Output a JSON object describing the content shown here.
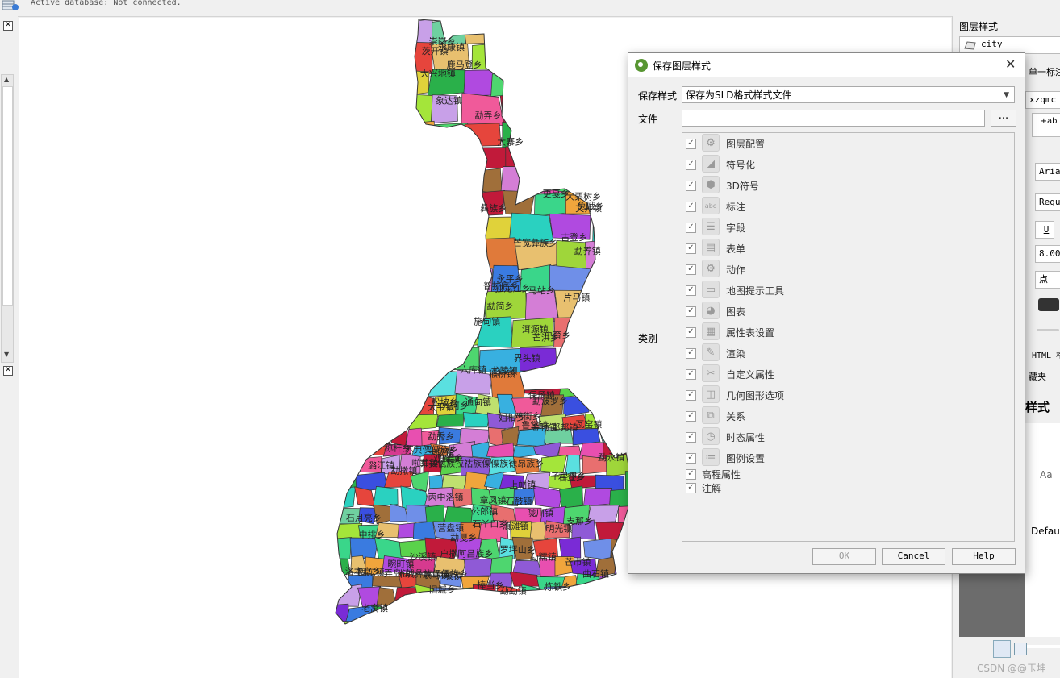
{
  "status": {
    "active_db": "Active database: Not connected."
  },
  "map": {
    "places": [
      "丙中洛镇",
      "捧当乡",
      "独龙江乡",
      "茨开镇",
      "普拉底乡",
      "马吉乡",
      "石月亮乡",
      "鹿马登乡",
      "中排乡",
      "上帕镇",
      "营盘镇",
      "子里甲乡",
      "兔峨乡",
      "石登乡",
      "通甸镇",
      "啦井镇",
      "金顶镇",
      "洛本卓乡",
      "称杆乡",
      "古登乡",
      "片马镇",
      "大兴地镇",
      "鲁掌镇",
      "六库镇",
      "老窝镇",
      "明光镇",
      "滇滩镇",
      "界头镇",
      "马站乡",
      "猴桥镇",
      "固东镇",
      "芒宽彝族乡",
      "苏典傈僳族乡",
      "支那乡",
      "卡场镇",
      "勐弄乡",
      "那邦镇",
      "户撒阿昌族乡",
      "太平镇",
      "勐养镇",
      "陇川镇",
      "章凤镇",
      "勐秀乡",
      "户育乡",
      "弄岛镇",
      "姐相乡",
      "畹町镇",
      "潞江镇",
      "龙陵镇",
      "勐糯镇",
      "永康镇",
      "芒市镇",
      "军赛佤族拉祜族傈僳族德昂族乡",
      "勐永镇",
      "木城彝族傈僳族乡",
      "象达镇",
      "施甸镇",
      "勐波罗乡",
      "九河乡",
      "石鼓镇",
      "洱源镇",
      "罗坪山乡",
      "炼铁乡",
      "双廊镇",
      "永平乡",
      "鸡街乡",
      "勐撒镇",
      "石丫口乡",
      "松坡乡",
      "耿马镇",
      "勐简乡",
      "崇岗乡",
      "芒洪乡",
      "大寨乡",
      "沙溪镇",
      "瓦窑镇",
      "平坡镇",
      "旧城乡",
      "更戛乡",
      "公郎镇",
      "彝族乡",
      "勐戛乡",
      "勐勐镇",
      "文井镇",
      "大栗树乡",
      "曲石镇",
      "保场镇"
    ]
  },
  "right_panel": {
    "title": "图层样式",
    "layer": "city",
    "tab": "单一标注",
    "field": "xzqmc",
    "font": "Arial",
    "weight": "Regular",
    "underline": "U",
    "size": "8.000",
    "unit": "点",
    "html_label": "HTML 格",
    "folder": "藏夹",
    "style_heading": "样式",
    "aa": "Aa",
    "default": "Defaul",
    "watermark": "CSDN @@玉坤"
  },
  "dialog": {
    "title": "保存图层样式",
    "style_label": "保存样式",
    "style_value": "保存为SLD格式样式文件",
    "file_label": "文件",
    "file_value": "",
    "browse": "...",
    "category_label": "类别",
    "categories": [
      {
        "label": "图层配置",
        "icon": "layer-config-icon",
        "glyph": "⚙",
        "checked": true
      },
      {
        "label": "符号化",
        "icon": "symbology-icon",
        "glyph": "◢",
        "checked": true
      },
      {
        "label": "3D符号",
        "icon": "3d-symbol-icon",
        "glyph": "⬢",
        "checked": true
      },
      {
        "label": "标注",
        "icon": "labels-icon",
        "glyph": "abc",
        "checked": true
      },
      {
        "label": "字段",
        "icon": "fields-icon",
        "glyph": "☰",
        "checked": true
      },
      {
        "label": "表单",
        "icon": "forms-icon",
        "glyph": "▤",
        "checked": true
      },
      {
        "label": "动作",
        "icon": "actions-icon",
        "glyph": "⚙",
        "checked": true
      },
      {
        "label": "地图提示工具",
        "icon": "map-tips-icon",
        "glyph": "▭",
        "checked": true
      },
      {
        "label": "图表",
        "icon": "diagrams-icon",
        "glyph": "◕",
        "checked": true
      },
      {
        "label": "属性表设置",
        "icon": "attribute-table-icon",
        "glyph": "▦",
        "checked": true
      },
      {
        "label": "渲染",
        "icon": "rendering-icon",
        "glyph": "✎",
        "checked": true
      },
      {
        "label": "自定义属性",
        "icon": "custom-properties-icon",
        "glyph": "✂",
        "checked": true
      },
      {
        "label": "几何图形选项",
        "icon": "geometry-options-icon",
        "glyph": "◫",
        "checked": true
      },
      {
        "label": "关系",
        "icon": "relations-icon",
        "glyph": "⧉",
        "checked": true
      },
      {
        "label": "时态属性",
        "icon": "temporal-icon",
        "glyph": "◷",
        "checked": true
      },
      {
        "label": "图例设置",
        "icon": "legend-icon",
        "glyph": "≔",
        "checked": true
      },
      {
        "label": "高程属性",
        "icon": "",
        "glyph": "",
        "checked": true
      },
      {
        "label": "注解",
        "icon": "",
        "glyph": "",
        "checked": true
      }
    ],
    "buttons": {
      "ok": "OK",
      "cancel": "Cancel",
      "help": "Help"
    }
  }
}
